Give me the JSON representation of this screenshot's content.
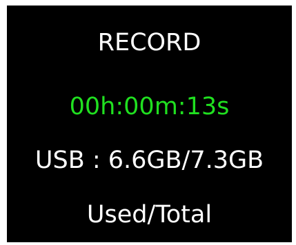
{
  "screen": {
    "mode_title": "RECORD",
    "timer": "00h:00m:13s",
    "storage": "USB : 6.6GB/7.3GB",
    "storage_legend": "Used/Total"
  },
  "colors": {
    "background": "#000000",
    "text": "#ffffff",
    "timer": "#20e020",
    "frame": "#ffffff"
  }
}
